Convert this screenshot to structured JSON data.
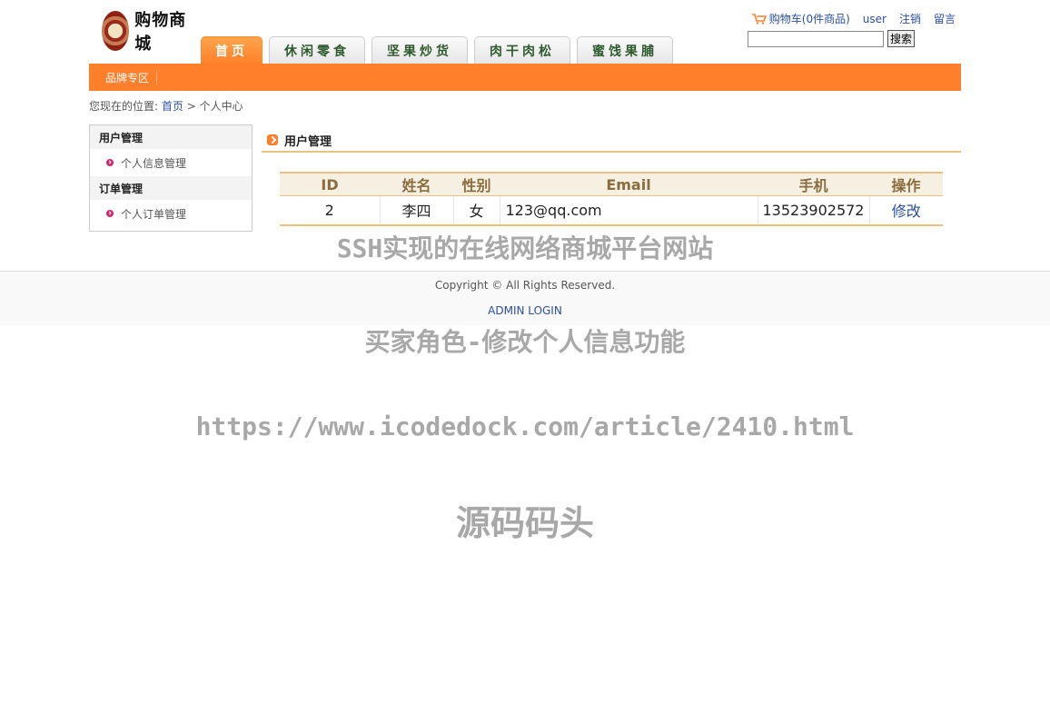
{
  "header": {
    "logo_text": "购物商城",
    "cart_label": "购物车(0件商品)",
    "user_label": "user",
    "logout_label": "注销",
    "message_label": "留言",
    "search_value": "",
    "search_button": "搜索"
  },
  "nav": {
    "tabs": [
      {
        "label": "首页",
        "active": true
      },
      {
        "label": "休闲零食"
      },
      {
        "label": "坚果炒货"
      },
      {
        "label": "肉干肉松"
      },
      {
        "label": "蜜饯果脯"
      }
    ],
    "brand_zone": "品牌专区"
  },
  "breadcrumb": {
    "prefix": "您现在的位置:",
    "home": "首页",
    "separator": ">",
    "current": "个人中心"
  },
  "sidebar": {
    "groups": [
      {
        "title": "用户管理",
        "items": [
          "个人信息管理"
        ]
      },
      {
        "title": "订单管理",
        "items": [
          "个人订单管理"
        ]
      }
    ]
  },
  "content": {
    "title": "用户管理",
    "table": {
      "headers": [
        "ID",
        "姓名",
        "性别",
        "Email",
        "手机",
        "操作"
      ],
      "rows": [
        {
          "id": "2",
          "name": "李四",
          "gender": "女",
          "email": "123@qq.com",
          "phone": "13523902572",
          "action": "修改"
        }
      ]
    }
  },
  "footer": {
    "copyright": "Copyright © All Rights Reserved.",
    "admin_login": "ADMIN LOGIN"
  },
  "watermarks": {
    "line1": "SSH实现的在线网络商城平台网站",
    "line2": "买家角色-修改个人信息功能",
    "line3": "https://www.icodedock.com/article/2410.html",
    "line4": "源码码头"
  },
  "colors": {
    "accent": "#ff7f2a",
    "link": "#2b4f9a",
    "table_header_text": "#8a6d3e",
    "table_border": "#e8c285"
  }
}
